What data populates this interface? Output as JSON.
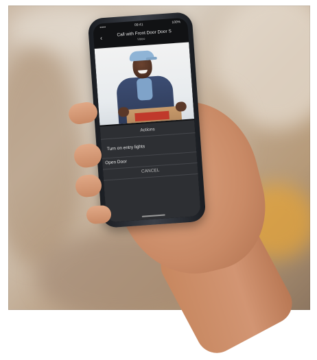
{
  "status_bar": {
    "carrier": "•••••",
    "time": "09:41",
    "battery": "100%"
  },
  "title_bar": {
    "title": "Call with Front Door Door S",
    "subtitle": "Video"
  },
  "action_sheet": {
    "title": "Actions",
    "items": [
      {
        "label": "Turn on entry lights"
      },
      {
        "label": "Open Door"
      }
    ],
    "cancel_label": "CANCEL"
  },
  "icons": {
    "back": "back-arrow-icon"
  },
  "colors": {
    "sheet_background": "#2d2f33",
    "cap": "#8fb4d6",
    "box_label": "#c0392b"
  }
}
